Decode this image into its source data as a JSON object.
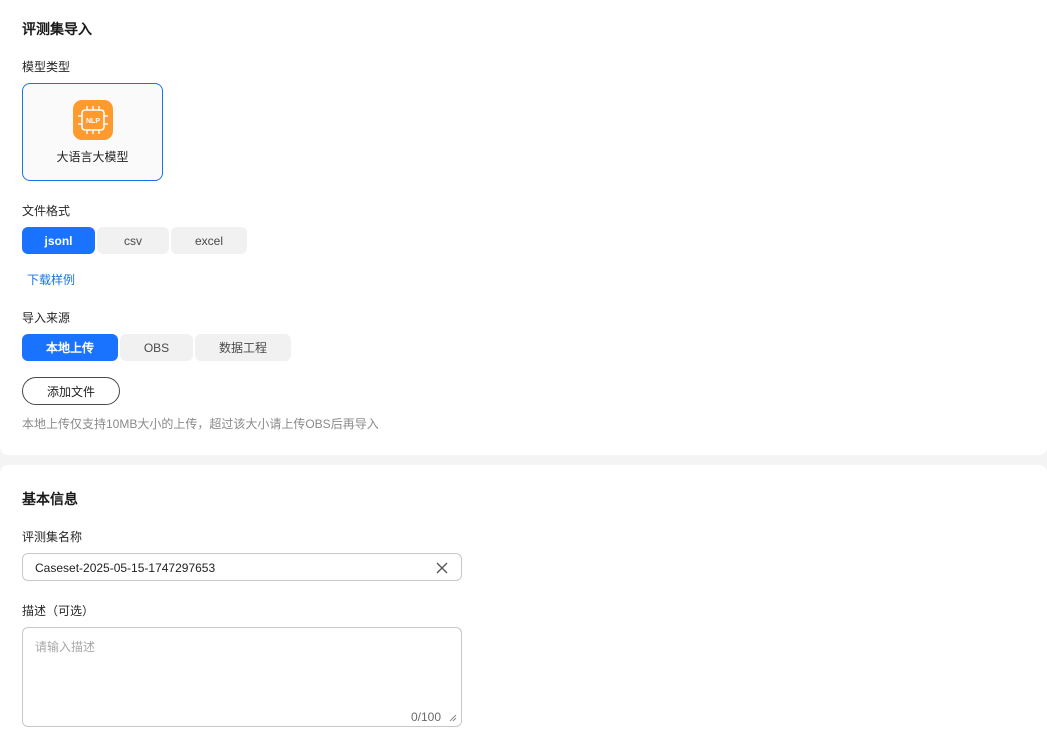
{
  "import_section": {
    "title": "评测集导入",
    "model_type_label": "模型类型",
    "model_card": {
      "label": "大语言大模型",
      "icon_text": "NLP",
      "icon": "nlp-chip-icon"
    },
    "file_format_label": "文件格式",
    "file_formats": [
      {
        "label": "jsonl",
        "selected": true
      },
      {
        "label": "csv",
        "selected": false
      },
      {
        "label": "excel",
        "selected": false
      }
    ],
    "download_sample": "下载样例",
    "source_label": "导入来源",
    "sources": [
      {
        "label": "本地上传",
        "selected": true
      },
      {
        "label": "OBS",
        "selected": false
      },
      {
        "label": "数据工程",
        "selected": false
      }
    ],
    "add_file_button": "添加文件",
    "hint": "本地上传仅支持10MB大小的上传，超过该大小请上传OBS后再导入"
  },
  "basic_section": {
    "title": "基本信息",
    "name_label": "评测集名称",
    "name_value": "Caseset-2025-05-15-1747297653",
    "desc_label": "描述（可选）",
    "desc_placeholder": "请输入描述",
    "desc_counter": "0/100"
  },
  "colors": {
    "accent": "#1a73ff",
    "icon_orange": "#ff9a2e",
    "page_bg": "#f4f4f5"
  }
}
